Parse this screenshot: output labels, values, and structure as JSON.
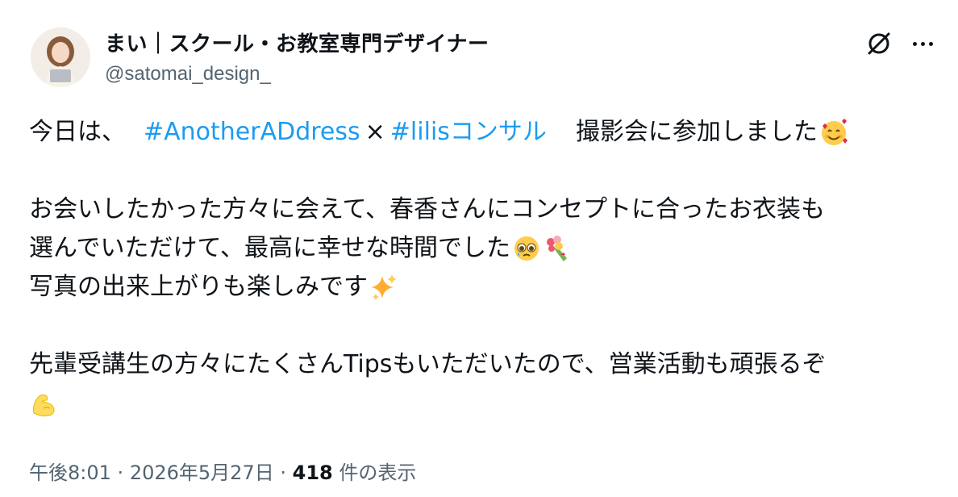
{
  "author": {
    "display_name": "まい｜スクール・お教室専門デザイナー",
    "handle": "@satomai_design_"
  },
  "header_icons": [
    "grok-icon",
    "more-icon"
  ],
  "tweet": {
    "line1_pre": "今日は、",
    "hashtag1": "#AnotherADdress",
    "times": "×",
    "hashtag2": "#lilisコンサル",
    "line1_post": "撮影会に参加しました",
    "line2": "お会いしたかった方々に会えて、春香さんにコンセプトに合ったお衣装も",
    "line3": "選んでいただけて、最高に幸せな時間でした",
    "line4": "写真の出来上がりも楽しみです",
    "line5": "先輩受講生の方々にたくさんTipsもいただいたので、営業活動も頑張るぞ",
    "emojis": [
      "smiling-face-with-hearts",
      "pleading-face",
      "bouquet",
      "sparkles",
      "flexed-biceps"
    ]
  },
  "meta": {
    "time": "午後8:01",
    "sep1": "·",
    "date": "2026年5月27日",
    "sep2": "·",
    "views_count": "418",
    "views_label": "件の表示"
  },
  "colors": {
    "link": "#1d9bf0",
    "secondary": "#536471",
    "text": "#0f1419"
  }
}
